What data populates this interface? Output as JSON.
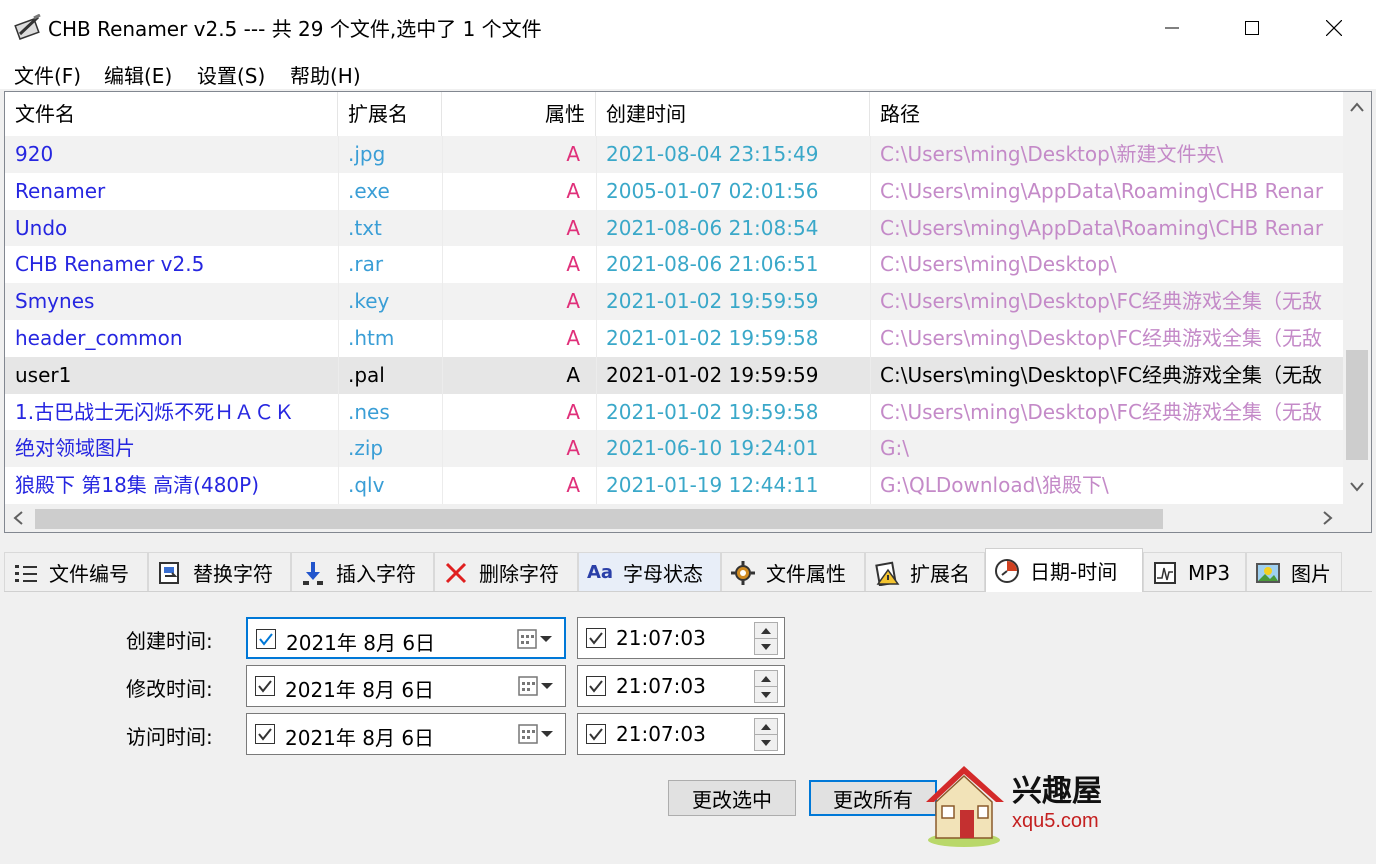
{
  "window": {
    "title": "CHB Renamer v2.5 --- 共 29 个文件,选中了 1 个文件",
    "minimize": "—",
    "maximize": "☐",
    "close": "✕"
  },
  "menu": [
    "文件(F)",
    "编辑(E)",
    "设置(S)",
    "帮助(H)"
  ],
  "list": {
    "columns": [
      "文件名",
      "扩展名",
      "属性",
      "创建时间",
      "路径"
    ],
    "rows": [
      {
        "name": "920",
        "ext": ".jpg",
        "attr": "A",
        "created": "2021-08-04 23:15:49",
        "path": "C:\\Users\\ming\\Desktop\\新建文件夹\\"
      },
      {
        "name": "Renamer",
        "ext": ".exe",
        "attr": "A",
        "created": "2005-01-07 02:01:56",
        "path": "C:\\Users\\ming\\AppData\\Roaming\\CHB Renar"
      },
      {
        "name": "Undo",
        "ext": ".txt",
        "attr": "A",
        "created": "2021-08-06 21:08:54",
        "path": "C:\\Users\\ming\\AppData\\Roaming\\CHB Renar"
      },
      {
        "name": "CHB Renamer v2.5",
        "ext": ".rar",
        "attr": "A",
        "created": "2021-08-06 21:06:51",
        "path": "C:\\Users\\ming\\Desktop\\"
      },
      {
        "name": "Smynes",
        "ext": ".key",
        "attr": "A",
        "created": "2021-01-02 19:59:59",
        "path": "C:\\Users\\ming\\Desktop\\FC经典游戏全集（无敌"
      },
      {
        "name": "header_common",
        "ext": ".htm",
        "attr": "A",
        "created": "2021-01-02 19:59:58",
        "path": "C:\\Users\\ming\\Desktop\\FC经典游戏全集（无敌"
      },
      {
        "name": "user1",
        "ext": ".pal",
        "attr": "A",
        "created": "2021-01-02 19:59:59",
        "path": "C:\\Users\\ming\\Desktop\\FC经典游戏全集（无敌"
      },
      {
        "name": "1.古巴战士无闪烁不死ＨＡＣＫ",
        "ext": ".nes",
        "attr": "A",
        "created": "2021-01-02 19:59:58",
        "path": "C:\\Users\\ming\\Desktop\\FC经典游戏全集（无敌"
      },
      {
        "name": "绝对领域图片",
        "ext": ".zip",
        "attr": "A",
        "created": "2021-06-10 19:24:01",
        "path": "G:\\"
      },
      {
        "name": "狼殿下 第18集 高清(480P)",
        "ext": ".qlv",
        "attr": "A",
        "created": "2021-01-19 12:44:11",
        "path": "G:\\QLDownload\\狼殿下\\"
      }
    ],
    "selected_index": 6
  },
  "tabs": [
    {
      "label": "文件编号",
      "icon": "numbered-list-icon"
    },
    {
      "label": "替换字符",
      "icon": "replace-icon"
    },
    {
      "label": "插入字符",
      "icon": "insert-icon"
    },
    {
      "label": "删除字符",
      "icon": "delete-x-icon"
    },
    {
      "label": "字母状态",
      "icon": "aa-case-icon",
      "glyph": "Aa"
    },
    {
      "label": "文件属性",
      "icon": "gear-icon"
    },
    {
      "label": "扩展名",
      "icon": "warning-doc-icon"
    },
    {
      "label": "日期-时间",
      "icon": "clock-icon",
      "active": true
    },
    {
      "label": "MP3",
      "icon": "audio-icon"
    },
    {
      "label": "图片",
      "icon": "picture-icon"
    }
  ],
  "datetime": {
    "created": {
      "label": "创建时间:",
      "date": "2021年  8月  6日",
      "time": "21:07:03",
      "checked": true
    },
    "modified": {
      "label": "修改时间:",
      "date": "2021年  8月  6日",
      "time": "21:07:03",
      "checked": true
    },
    "accessed": {
      "label": "访问时间:",
      "date": "2021年  8月  6日",
      "time": "21:07:03",
      "checked": true
    }
  },
  "buttons": {
    "change_selected": "更改选中",
    "change_all": "更改所有"
  },
  "watermark": {
    "brand": "兴趣屋",
    "url": "xqu5.com"
  },
  "colors": {
    "name": "#2626e0",
    "ext": "#3a9ed6",
    "attr": "#e0307a",
    "time": "#3aa8c9",
    "path": "#c48ac8",
    "focus": "#0078d7"
  }
}
